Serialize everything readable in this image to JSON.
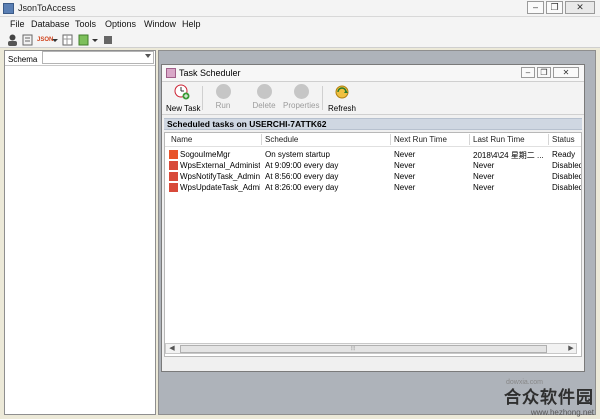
{
  "app": {
    "title": "JsonToAccess"
  },
  "window_buttons": {
    "minimize": "–",
    "restore": "❐",
    "close": "✕"
  },
  "menu": [
    "File",
    "Database",
    "Tools",
    "Options",
    "Window",
    "Help"
  ],
  "toolbar": {
    "icons": [
      "user-icon",
      "notes-icon",
      "json-icon",
      "dropdown-arrow",
      "grid-icon",
      "table-icon",
      "dropdown-arrow",
      "stop-icon"
    ],
    "json_label": "JSON"
  },
  "schema": {
    "label": "Schema",
    "value": ""
  },
  "task_scheduler": {
    "title": "Task Scheduler",
    "buttons": [
      {
        "label": "New Task",
        "icon": "clock-add-icon",
        "enabled": true
      },
      {
        "label": "Run",
        "icon": "run-icon",
        "enabled": false
      },
      {
        "label": "Delete",
        "icon": "delete-icon",
        "enabled": false
      },
      {
        "label": "Properties",
        "icon": "properties-icon",
        "enabled": false
      },
      {
        "label": "Refresh",
        "icon": "refresh-icon",
        "enabled": true
      }
    ],
    "header": "Scheduled tasks on USERCHI-7ATTK62",
    "columns": [
      "Name",
      "Schedule",
      "Next Run Time",
      "Last Run Time",
      "Status"
    ],
    "rows": [
      {
        "name": "SogouImeMgr",
        "schedule": "On system startup",
        "next_run": "Never",
        "last_run": "2018\\4\\24 星期二 ...",
        "status": "Ready",
        "icon_color": "#e8532a"
      },
      {
        "name": "WpsExternal_Administ...",
        "schedule": "At 9:09:00 every day",
        "next_run": "Never",
        "last_run": "Never",
        "status": "Disabled",
        "icon_color": "#d84a3a"
      },
      {
        "name": "WpsNotifyTask_Admini...",
        "schedule": "At 8:56:00 every day",
        "next_run": "Never",
        "last_run": "Never",
        "status": "Disabled",
        "icon_color": "#d84a3a"
      },
      {
        "name": "WpsUpdateTask_Admi...",
        "schedule": "At 8:26:00 every day",
        "next_run": "Never",
        "last_run": "Never",
        "status": "Disabled",
        "icon_color": "#d84a3a"
      }
    ],
    "scroll_center_glyph": "⦙⦙⦙"
  },
  "watermark": {
    "main": "合众软件园",
    "sub": "www.hezhong.net",
    "small": "dowxia.com"
  },
  "colors": {
    "mdi_bg": "#aeb3ba",
    "header_bg": "#cfd7e2"
  }
}
